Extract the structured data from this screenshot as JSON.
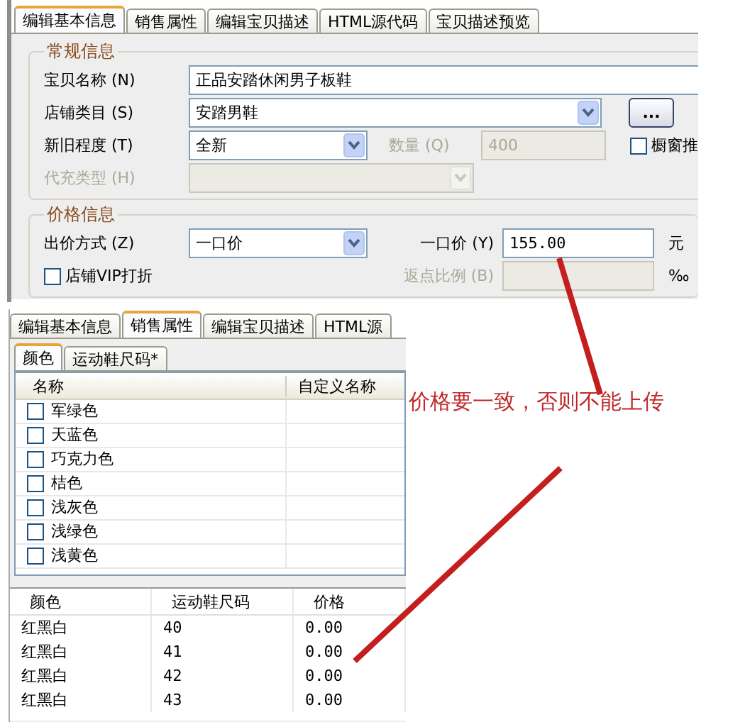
{
  "basic_info": {
    "tabs": [
      {
        "label": "编辑基本信息",
        "selected": true
      },
      {
        "label": "销售属性",
        "selected": false
      },
      {
        "label": "编辑宝贝描述",
        "selected": false
      },
      {
        "label": "HTML源代码",
        "selected": false
      },
      {
        "label": "宝贝描述预览",
        "selected": false
      }
    ],
    "general_group": {
      "title": "常规信息",
      "name": {
        "label": "宝贝名称 (N)",
        "value": "正品安踏休闲男子板鞋"
      },
      "category": {
        "label": "店铺类目 (S)",
        "value": "安踏男鞋",
        "more_button": "..."
      },
      "condition": {
        "label": "新旧程度 (T)",
        "value": "全新"
      },
      "quantity": {
        "label": "数量 (Q)",
        "value": "400",
        "disabled": true
      },
      "showcase": {
        "label": "橱窗推",
        "checked": false
      },
      "recharge_type": {
        "label": "代充类型 (H)",
        "disabled": true
      }
    },
    "price_group": {
      "title": "价格信息",
      "method": {
        "label": "出价方式 (Z)",
        "value": "一口价"
      },
      "fixed_price": {
        "label": "一口价 (Y)",
        "value": "155.00",
        "unit": "元"
      },
      "vip_discount": {
        "label": "店铺VIP打折",
        "checked": false
      },
      "rebate": {
        "label": "返点比例 (B)",
        "unit": "‰",
        "disabled": true
      }
    }
  },
  "sales_panel": {
    "tabs": [
      {
        "label": "编辑基本信息",
        "selected": false
      },
      {
        "label": "销售属性",
        "selected": true
      },
      {
        "label": "编辑宝贝描述",
        "selected": false
      },
      {
        "label": "HTML源",
        "selected": false
      }
    ],
    "sub_tabs": [
      {
        "label": "颜色",
        "selected": true
      },
      {
        "label": "运动鞋尺码*",
        "selected": false
      }
    ],
    "list": {
      "columns": [
        "名称",
        "自定义名称"
      ],
      "items": [
        {
          "name": "军绿色",
          "checked": false
        },
        {
          "name": "天蓝色",
          "checked": false
        },
        {
          "name": "巧克力色",
          "checked": false
        },
        {
          "name": "桔色",
          "checked": false
        },
        {
          "name": "浅灰色",
          "checked": false
        },
        {
          "name": "浅绿色",
          "checked": false
        },
        {
          "name": "浅黄色",
          "checked": false
        }
      ]
    },
    "sku_table": {
      "columns": [
        "颜色",
        "运动鞋尺码",
        "价格"
      ],
      "rows": [
        [
          "红黑白",
          "40",
          "0.00"
        ],
        [
          "红黑白",
          "41",
          "0.00"
        ],
        [
          "红黑白",
          "42",
          "0.00"
        ],
        [
          "红黑白",
          "43",
          "0.00"
        ]
      ]
    }
  },
  "annotation": {
    "text": "价格要一致，否则不能上传"
  }
}
